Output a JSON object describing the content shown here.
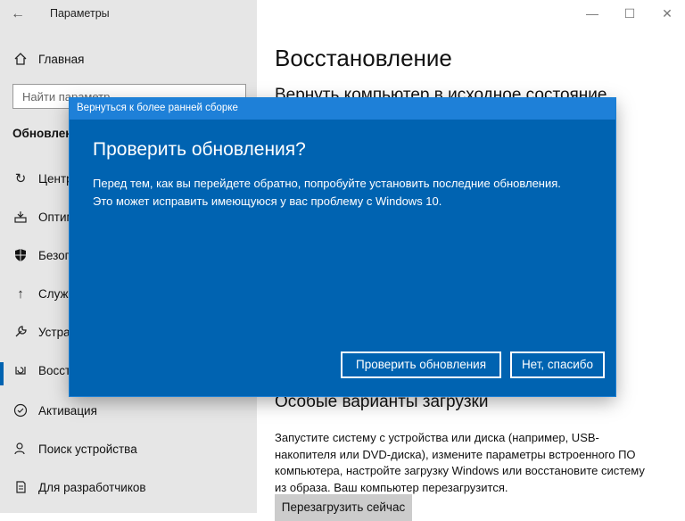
{
  "window": {
    "title": "Параметры",
    "controls": {
      "minimize": "—",
      "maximize": "☐",
      "close": "✕"
    }
  },
  "sidebar": {
    "home_label": "Главная",
    "search_placeholder": "Найти параметр",
    "section_title": "Обновление и безопасность",
    "items": [
      {
        "label": "Центр обновления Windows",
        "icon": "refresh-icon"
      },
      {
        "label": "Оптимизация доставки",
        "icon": "delivery-icon"
      },
      {
        "label": "Безопасность Windows",
        "icon": "shield-icon"
      },
      {
        "label": "Служба архивации",
        "icon": "backup-arrow-icon"
      },
      {
        "label": "Устранение неполадок",
        "icon": "wrench-icon"
      },
      {
        "label": "Восстановление",
        "icon": "recovery-icon",
        "selected": true
      },
      {
        "label": "Активация",
        "icon": "check-circle-icon"
      },
      {
        "label": "Поиск устройства",
        "icon": "person-locate-icon"
      },
      {
        "label": "Для разработчиков",
        "icon": "developer-icon"
      }
    ]
  },
  "main": {
    "title": "Восстановление",
    "reset_heading": "Вернуть компьютер в исходное состояние",
    "advanced_heading": "Особые варианты загрузки",
    "advanced_text": "Запустите систему с устройства или диска (например, USB-накопителя или DVD-диска), измените параметры встроенного ПО компьютера, настройте загрузку Windows или восстановите систему из образа. Ваш компьютер перезагрузится.",
    "restart_button": "Перезагрузить сейчас"
  },
  "dialog": {
    "title": "Вернуться к более ранней сборке",
    "heading": "Проверить обновления?",
    "body_line1": "Перед тем, как вы перейдете обратно, попробуйте установить последние обновления.",
    "body_line2": "Это может исправить имеющуюся у вас проблему с Windows 10.",
    "check_button": "Проверить обновления",
    "no_button": "Нет, спасибо"
  },
  "colors": {
    "accent": "#0063b1",
    "dialog_title": "#1e80d8",
    "sidebar_bg": "#e6e6e6"
  }
}
